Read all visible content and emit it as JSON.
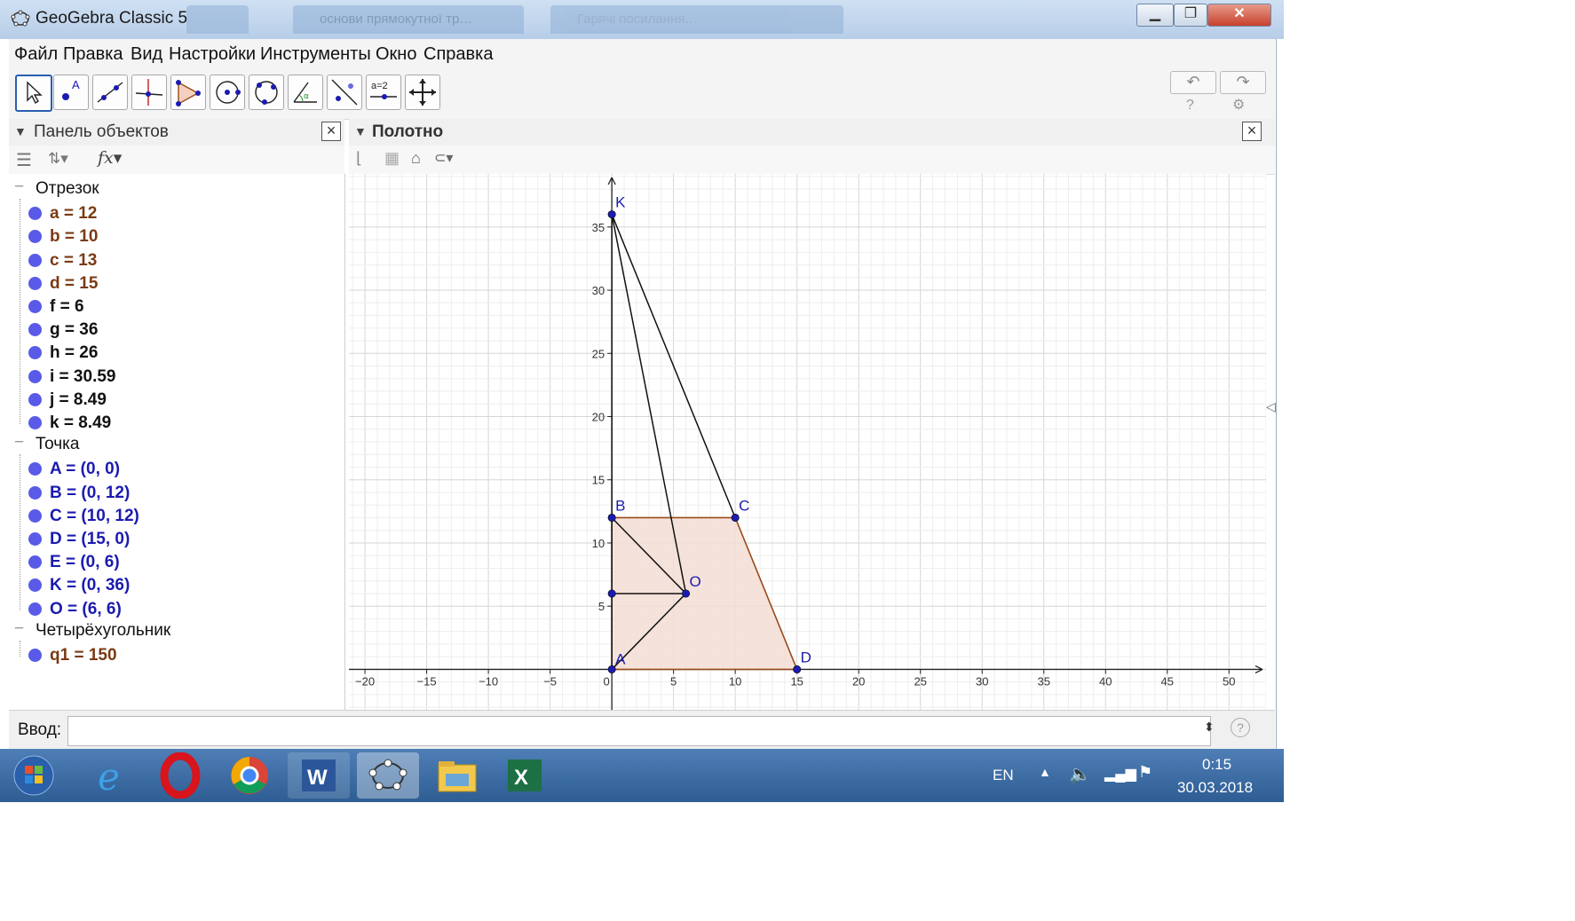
{
  "window": {
    "title": "GeoGebra Classic 5",
    "bg_tabs": [
      "основи прямокутної тр…",
      "Гарячі посилання…"
    ]
  },
  "menu": [
    "Файл",
    "Правка",
    "Вид",
    "Настройки",
    "Инструменты",
    "Окно",
    "Справка"
  ],
  "toolbar": {
    "tools": [
      "move-tool-icon",
      "point-tool-icon",
      "line-tool-icon",
      "perpendicular-tool-icon",
      "polygon-tool-icon",
      "circle-tool-icon",
      "conic-tool-icon",
      "angle-tool-icon",
      "reflect-tool-icon",
      "slider-tool-icon",
      "move-view-tool-icon"
    ],
    "slider_tool_text": "a=2"
  },
  "algebra_panel": {
    "title": "Панель объектов",
    "groups": [
      {
        "label": "Отрезок",
        "items": [
          {
            "text": "a = 12",
            "color": "#7a3a14"
          },
          {
            "text": "b = 10",
            "color": "#7a3a14"
          },
          {
            "text": "c = 13",
            "color": "#7a3a14"
          },
          {
            "text": "d = 15",
            "color": "#7a3a14"
          },
          {
            "text": "f = 6",
            "color": "#111111"
          },
          {
            "text": "g = 36",
            "color": "#111111"
          },
          {
            "text": "h = 26",
            "color": "#111111"
          },
          {
            "text": "i = 30.59",
            "color": "#111111"
          },
          {
            "text": "j = 8.49",
            "color": "#111111"
          },
          {
            "text": "k = 8.49",
            "color": "#111111"
          }
        ]
      },
      {
        "label": "Точка",
        "items": [
          {
            "text": "A = (0, 0)",
            "color": "#1b1bb0"
          },
          {
            "text": "B = (0, 12)",
            "color": "#1b1bb0"
          },
          {
            "text": "C = (10, 12)",
            "color": "#1b1bb0"
          },
          {
            "text": "D = (15, 0)",
            "color": "#1b1bb0"
          },
          {
            "text": "E = (0, 6)",
            "color": "#1b1bb0"
          },
          {
            "text": "K = (0, 36)",
            "color": "#1b1bb0"
          },
          {
            "text": "O = (6, 6)",
            "color": "#1b1bb0"
          }
        ]
      },
      {
        "label": "Четырёхугольник",
        "items": [
          {
            "text": "q1 = 150",
            "color": "#7a3a14"
          }
        ]
      }
    ]
  },
  "graphics": {
    "title": "Полотно",
    "x_ticks": [
      -20,
      -15,
      -10,
      -5,
      0,
      5,
      10,
      15,
      20,
      25,
      30,
      35,
      40,
      45,
      50
    ],
    "y_ticks": [
      5,
      10,
      15,
      20,
      25,
      30,
      35
    ],
    "xlim": [
      -21.3,
      53
    ],
    "ylim": [
      -3.2,
      39.2
    ],
    "points": [
      {
        "name": "A",
        "x": 0,
        "y": 0,
        "label": "A"
      },
      {
        "name": "B",
        "x": 0,
        "y": 12,
        "label": "B"
      },
      {
        "name": "C",
        "x": 10,
        "y": 12,
        "label": "C"
      },
      {
        "name": "D",
        "x": 15,
        "y": 0,
        "label": "D"
      },
      {
        "name": "E",
        "x": 0,
        "y": 6,
        "label": ""
      },
      {
        "name": "K",
        "x": 0,
        "y": 36,
        "label": "K"
      },
      {
        "name": "O",
        "x": 6,
        "y": 6,
        "label": "O"
      }
    ],
    "polygon": [
      "A",
      "B",
      "C",
      "D"
    ],
    "segments": [
      [
        "K",
        "O"
      ],
      [
        "K",
        "C"
      ],
      [
        "B",
        "O"
      ],
      [
        "E",
        "O"
      ],
      [
        "A",
        "O"
      ],
      [
        "A",
        "K"
      ]
    ],
    "polygon_fill": "#f3ddd3",
    "polygon_stroke": "#9a4a1a",
    "point_color": "#1b1bb0",
    "label_color": "#1b1bb0"
  },
  "input_bar": {
    "label": "Ввод:",
    "placeholder": ""
  },
  "taskbar": {
    "apps": [
      "windows-start-icon",
      "internet-explorer-icon",
      "opera-icon",
      "chrome-icon",
      "word-icon",
      "geogebra-icon",
      "explorer-icon",
      "excel-icon"
    ],
    "lang": "EN",
    "time": "0:15",
    "date": "30.03.2018"
  }
}
